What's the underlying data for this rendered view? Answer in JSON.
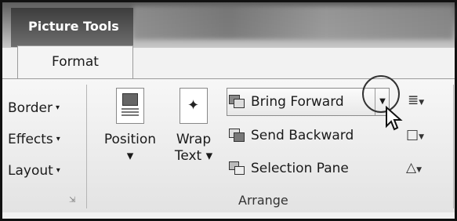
{
  "contextual_tab": {
    "label": "Picture Tools"
  },
  "active_tab": {
    "label": "Format"
  },
  "left_group": {
    "items": [
      {
        "label": "Border",
        "caret": "▾"
      },
      {
        "label": "Effects",
        "caret": "▾"
      },
      {
        "label": "Layout",
        "caret": "▾"
      }
    ]
  },
  "position_button": {
    "line1": "Position",
    "line2": "▾"
  },
  "wrap_button": {
    "line1": "Wrap",
    "line2": "Text ▾"
  },
  "arrange": {
    "bring_forward": "Bring Forward",
    "send_backward": "Send Backward",
    "selection_pane": "Selection Pane",
    "group_label": "Arrange"
  },
  "icons": {
    "align": "align-icon",
    "group": "group-icon",
    "rotate": "rotate-icon",
    "dialog_launcher": "dialog-launcher-icon"
  }
}
